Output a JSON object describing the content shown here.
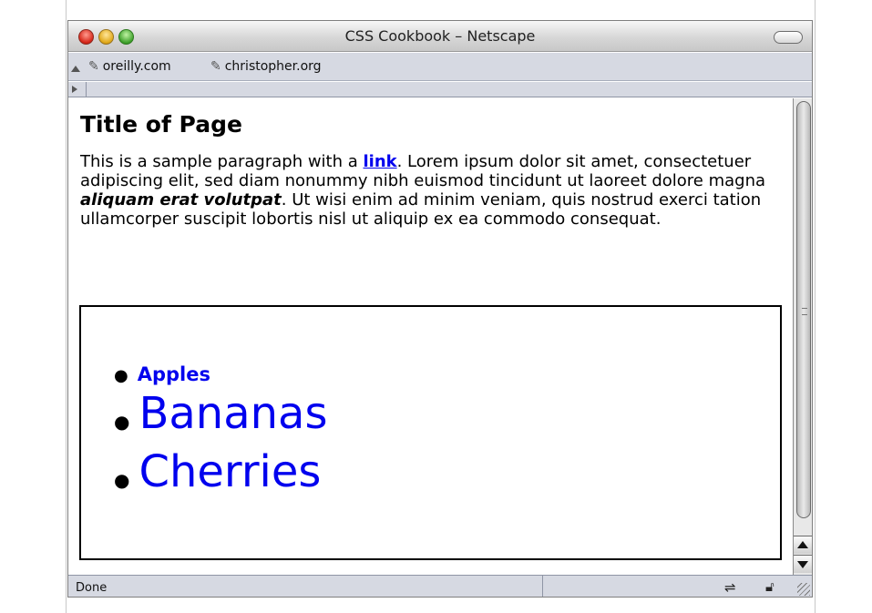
{
  "window": {
    "title": "CSS Cookbook – Netscape"
  },
  "bookmarks": [
    {
      "label": "oreilly.com",
      "icon": "bookmark-icon"
    },
    {
      "label": "christopher.org",
      "icon": "bookmark-icon"
    }
  ],
  "page": {
    "title": "Title of Page",
    "paragraph": {
      "before_link": "This is a sample paragraph with a ",
      "link": "link",
      "after_link": ". Lorem ipsum dolor sit amet, consectetuer adipiscing elit, sed diam nonummy nibh euismod tincidunt ut laoreet dolore magna ",
      "emphasis": "aliquam erat volutpat",
      "after_emphasis": ". Ut wisi enim ad minim veniam, quis nostrud exerci tation ullamcorper suscipit lobortis nisl ut aliquip ex ea commodo consequat."
    },
    "list": [
      {
        "label": "Apples"
      },
      {
        "label": "Bananas"
      },
      {
        "label": "Cherries"
      }
    ]
  },
  "status": {
    "text": "Done"
  },
  "colors": {
    "link": "#0000ee",
    "chrome": "#d6d9e2"
  }
}
